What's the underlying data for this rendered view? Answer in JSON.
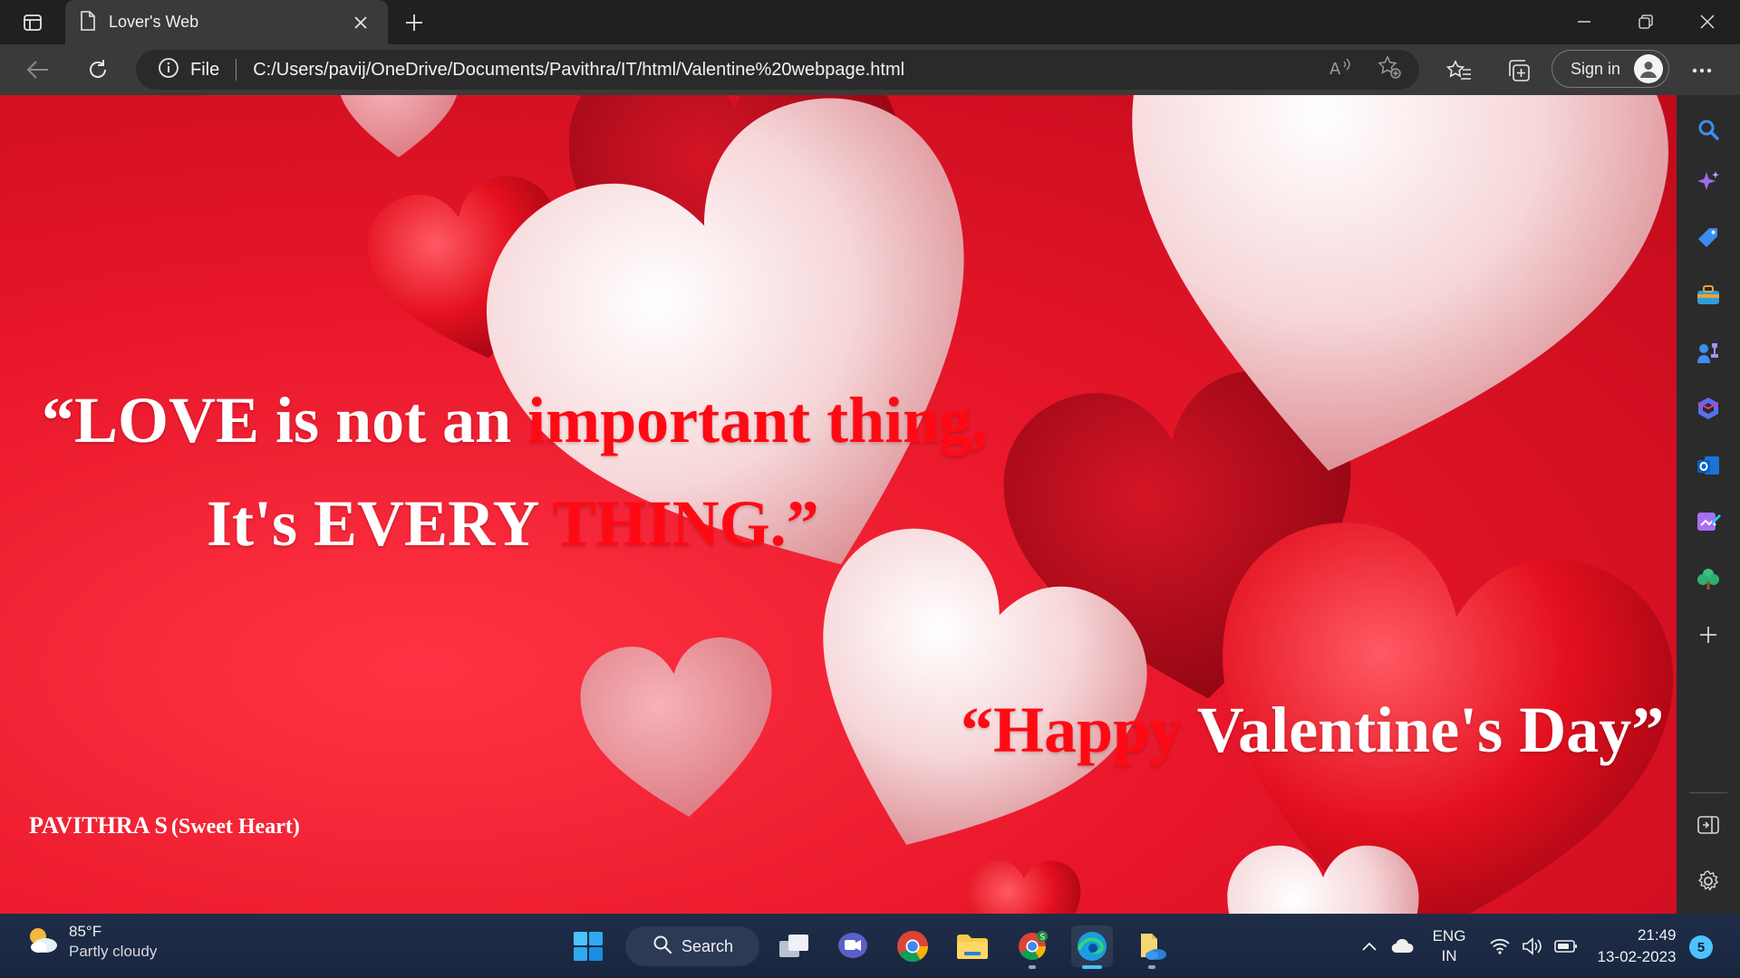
{
  "browser": {
    "tab": {
      "title": "Lover's Web"
    },
    "address": {
      "scheme": "File",
      "url": "C:/Users/pavij/OneDrive/Documents/Pavithra/IT/html/Valentine%20webpage.html"
    },
    "signin_label": "Sign in"
  },
  "page": {
    "quote": {
      "line1_white": "“LOVE is not an ",
      "line1_red": "important thing,",
      "line2_white": "It's EVERY ",
      "line2_red": "THING.”"
    },
    "greeting": {
      "red": "“Happy ",
      "white": "Valentine's Day”"
    },
    "signature": {
      "name": "PAVITHRA S",
      "nickname": "(Sweet Heart)"
    }
  },
  "sidebar": {
    "items": [
      "search-icon",
      "copilot-icon",
      "shopping-icon",
      "tools-icon",
      "games-icon",
      "office-icon",
      "outlook-icon",
      "designer-icon",
      "tree-icon",
      "add-icon"
    ],
    "bottom": [
      "split-screen-icon",
      "settings-icon"
    ]
  },
  "taskbar": {
    "weather": {
      "temp": "85°F",
      "condition": "Partly cloudy"
    },
    "search_label": "Search",
    "language": {
      "line1": "ENG",
      "line2": "IN"
    },
    "clock": {
      "time": "21:49",
      "date": "13-02-2023"
    },
    "notifications": "5"
  },
  "colors": {
    "accent_red": "#ff0a14",
    "background_red": "#e8162a",
    "taskbar": "#1c2a44",
    "edge_accent": "#4cc2ff"
  }
}
